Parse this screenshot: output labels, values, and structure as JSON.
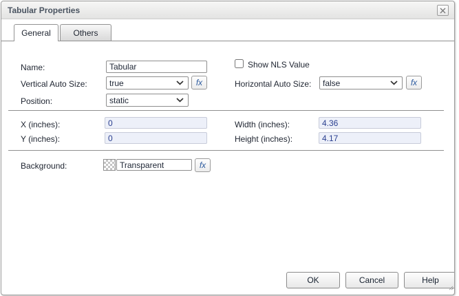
{
  "window": {
    "title": "Tabular Properties"
  },
  "tabs": [
    {
      "label": "General",
      "active": true
    },
    {
      "label": "Others",
      "active": false
    }
  ],
  "form": {
    "name": {
      "label": "Name:",
      "value": "Tabular"
    },
    "show_nls_value": {
      "label": "Show NLS Value",
      "checked": false
    },
    "vertical_auto_size": {
      "label": "Vertical Auto Size:",
      "value": "true"
    },
    "horizontal_auto_size": {
      "label": "Horizontal Auto Size:",
      "value": "false"
    },
    "position": {
      "label": "Position:",
      "value": "static"
    },
    "x_inches": {
      "label": "X (inches):",
      "value": "0"
    },
    "y_inches": {
      "label": "Y (inches):",
      "value": "0"
    },
    "width_inches": {
      "label": "Width (inches):",
      "value": "4.36"
    },
    "height_inches": {
      "label": "Height (inches):",
      "value": "4.17"
    },
    "background": {
      "label": "Background:",
      "value": "Transparent",
      "swatch": "transparent-checkerboard"
    }
  },
  "fx_button_label": "fx",
  "buttons": {
    "ok": "OK",
    "cancel": "Cancel",
    "help": "Help"
  },
  "icons": {
    "close": "x-in-box",
    "dropdown": "chevron-down",
    "resize": "diagonal-grip"
  },
  "colors": {
    "title_text": "#4a5461",
    "readonly_bg": "#edf0f9",
    "readonly_text": "#2a3f8f",
    "fx_text": "#2d5b9f",
    "separator": "#8f8f8f",
    "border": "#9b9b9b"
  }
}
